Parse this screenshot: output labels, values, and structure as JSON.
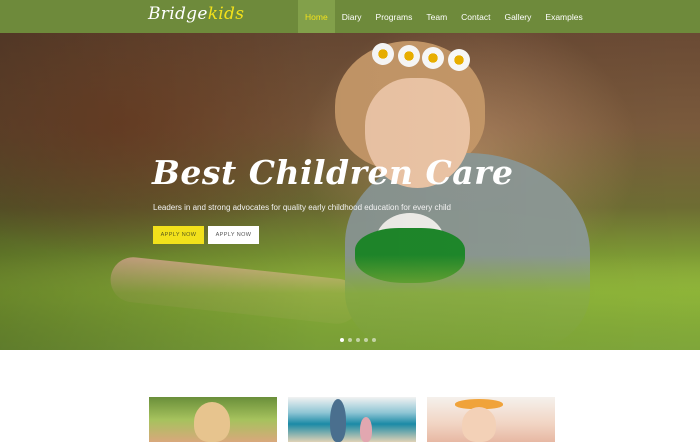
{
  "brand": {
    "logo_main": "Bridge",
    "logo_accent": "kids"
  },
  "nav": {
    "items": [
      {
        "label": "Home",
        "active": true
      },
      {
        "label": "Diary"
      },
      {
        "label": "Programs"
      },
      {
        "label": "Team"
      },
      {
        "label": "Contact"
      },
      {
        "label": "Gallery"
      },
      {
        "label": "Examples"
      }
    ]
  },
  "hero": {
    "title": "Best Children Care",
    "subtitle": "Leaders in and strong advocates for quality early childhood education for every child",
    "primary_button": "APPLY NOW",
    "secondary_button": "APPLY NOW"
  },
  "slider": {
    "slide_count": 5,
    "active_index": 0
  },
  "colors": {
    "nav_bg": "#6e8a3b",
    "nav_active_bg": "#82a04a",
    "accent_yellow": "#f2e11b",
    "white": "#ffffff"
  },
  "icons": {
    "slider_dot": "dot-icon"
  }
}
